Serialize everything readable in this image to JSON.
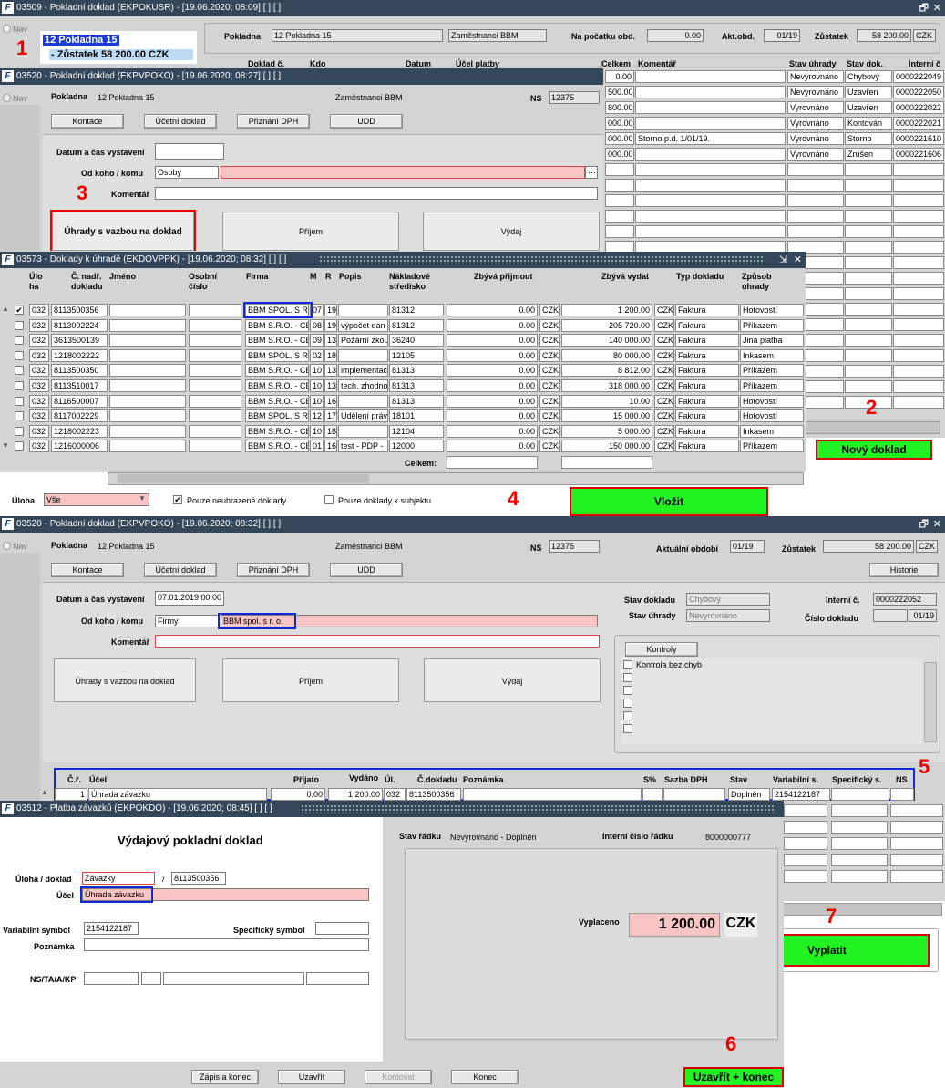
{
  "win1": {
    "title": "03509 - Pokladní doklad (EKPOKUSR) - [19.06.2020; 08:09]  [ ]  [ ]",
    "nav": "Nav",
    "tree_item1": "12 Pokladna 15",
    "tree_item2": "- Zůstatek 58 200.00 CZK",
    "lbl_pokladna": "Pokladna",
    "pokladna_value": "12 Pokladna 15",
    "zam_value": "Zaměstnanci BBM",
    "lbl_pocatek": "Na počátku obd.",
    "pocatek_value": "0.00",
    "lbl_akt": "Akt.obd.",
    "akt_value": "01/19",
    "lbl_zust": "Zůstatek",
    "zust_value": "58 200.00",
    "zust_cur": "CZK",
    "headers": {
      "doklad": "Doklad č.",
      "kdo": "Kdo",
      "datum": "Datum",
      "ucel": "Účel platby",
      "celkem": "Celkem",
      "koment": "Komentář",
      "stav_uhr": "Stav úhrady",
      "stav_dok": "Stav dok.",
      "interni": "Interní č"
    },
    "rows": [
      {
        "celkem": "0.00",
        "koment": "",
        "stav_uhr": "Nevyrovnáno",
        "stav_dok": "Chybový",
        "interni": "0000222049"
      },
      {
        "celkem": "500.00",
        "koment": "",
        "stav_uhr": "Nevyrovnáno",
        "stav_dok": "Uzavřen",
        "interni": "0000222050"
      },
      {
        "celkem": "800.00",
        "koment": "",
        "stav_uhr": "Vyrovnáno",
        "stav_dok": "Uzavřen",
        "interni": "0000222022"
      },
      {
        "celkem": "000.00",
        "koment": "",
        "stav_uhr": "Vyrovnáno",
        "stav_dok": "Kontován",
        "interni": "0000222021"
      },
      {
        "celkem": "000.00",
        "koment": "Storno p.d. 1/01/19.",
        "stav_uhr": "Vyrovnáno",
        "stav_dok": "Storno",
        "interni": "0000221610"
      },
      {
        "celkem": "000.00",
        "koment": "",
        "stav_uhr": "Vyrovnáno",
        "stav_dok": "Zrušen",
        "interni": "0000221606"
      }
    ],
    "btn_novy": "Nový doklad"
  },
  "win2": {
    "title": "03520 - Pokladní doklad (EKPVPOKO) - [19.06.2020; 08:27]  [ ]  [ ]",
    "nav": "Nav",
    "lbl_pokladna": "Pokladna",
    "pokladna_value": "12 Pokladna 15",
    "zam_value": "Zaměstnanci BBM",
    "lbl_ns": "NS",
    "ns_value": "12375",
    "btn_kontace": "Kontace",
    "btn_ucetni": "Účetní doklad",
    "btn_dph": "Přiznání DPH",
    "btn_udd": "UDD",
    "lbl_datum": "Datum a čas vystavení",
    "lbl_odkoho": "Od koho / komu",
    "odkoho_value": "Osoby",
    "lbl_koment": "Komentář",
    "btn_uhrady": "Úhrady s vazbou na doklad",
    "btn_prijem": "Příjem",
    "btn_vydej": "Výdaj"
  },
  "win3": {
    "title": "03573 - Doklady k úhradě (EKDOVPPK) - [19.06.2020; 08:32]  [ ]  [ ]",
    "headers": {
      "uloha": "Úlo ha",
      "nadr": "Č. nadř. dokladu",
      "jmeno": "Jméno",
      "osobni": "Osobní číslo",
      "firma": "Firma",
      "m": "M",
      "r": "R",
      "popis": "Popis",
      "nakl": "Nákladové středisko",
      "prijmout": "Zbývá přijmout",
      "vydat": "Zbývá vydat",
      "typ": "Typ dokladu",
      "zpusob": "Způsob úhrady"
    },
    "rows": [
      {
        "chk": "✔",
        "uloha": "032",
        "nadr": "8113500356",
        "firma": "BBM SPOL. S R",
        "m": "07",
        "r": "19",
        "popis": "",
        "nakl": "81312",
        "prijmout": "0.00",
        "cur1": "CZK",
        "vydat": "1 200.00",
        "cur2": "CZK",
        "typ": "Faktura",
        "zpusob": "Hotovostí"
      },
      {
        "chk": "",
        "uloha": "032",
        "nadr": "8113002224",
        "firma": "BBM S.R.O. - CE",
        "m": "08",
        "r": "19",
        "popis": "výpočet dan",
        "nakl": "81312",
        "prijmout": "0.00",
        "cur1": "CZK",
        "vydat": "205 720.00",
        "cur2": "CZK",
        "typ": "Faktura",
        "zpusob": "Příkazem"
      },
      {
        "chk": "",
        "uloha": "032",
        "nadr": "3613500139",
        "firma": "BBM S.R.O. - CE",
        "m": "09",
        "r": "13",
        "popis": "Požární zkou",
        "nakl": "36240",
        "prijmout": "0.00",
        "cur1": "CZK",
        "vydat": "140 000.00",
        "cur2": "CZK",
        "typ": "Faktura",
        "zpusob": "Jiná platba"
      },
      {
        "chk": "",
        "uloha": "032",
        "nadr": "1218002222",
        "firma": "BBM SPOL. S R",
        "m": "02",
        "r": "18",
        "popis": "",
        "nakl": "12105",
        "prijmout": "0.00",
        "cur1": "CZK",
        "vydat": "80 000.00",
        "cur2": "CZK",
        "typ": "Faktura",
        "zpusob": "Inkasem"
      },
      {
        "chk": "",
        "uloha": "032",
        "nadr": "8113500350",
        "firma": "BBM S.R.O. - CE",
        "m": "10",
        "r": "13",
        "popis": "implementac",
        "nakl": "81313",
        "prijmout": "0.00",
        "cur1": "CZK",
        "vydat": "8 812.00",
        "cur2": "CZK",
        "typ": "Faktura",
        "zpusob": "Příkazem"
      },
      {
        "chk": "",
        "uloha": "032",
        "nadr": "8113510017",
        "firma": "BBM S.R.O. - CE",
        "m": "10",
        "r": "13",
        "popis": "tech. zhodno",
        "nakl": "81313",
        "prijmout": "0.00",
        "cur1": "CZK",
        "vydat": "318 000.00",
        "cur2": "CZK",
        "typ": "Faktura",
        "zpusob": "Příkazem"
      },
      {
        "chk": "",
        "uloha": "032",
        "nadr": "8116500007",
        "firma": "BBM S.R.O. - CE",
        "m": "10",
        "r": "16",
        "popis": "",
        "nakl": "81313",
        "prijmout": "0.00",
        "cur1": "CZK",
        "vydat": "10.00",
        "cur2": "CZK",
        "typ": "Faktura",
        "zpusob": "Hotovostí"
      },
      {
        "chk": "",
        "uloha": "032",
        "nadr": "8117002229",
        "firma": "BBM SPOL. S R",
        "m": "12",
        "r": "17",
        "popis": "Udělení práv",
        "nakl": "18101",
        "prijmout": "0.00",
        "cur1": "CZK",
        "vydat": "15 000.00",
        "cur2": "CZK",
        "typ": "Faktura",
        "zpusob": "Hotovostí"
      },
      {
        "chk": "",
        "uloha": "032",
        "nadr": "1218002223",
        "firma": "BBM S.R.O. - CE",
        "m": "10",
        "r": "18",
        "popis": "",
        "nakl": "12104",
        "prijmout": "0.00",
        "cur1": "CZK",
        "vydat": "5 000.00",
        "cur2": "CZK",
        "typ": "Faktura",
        "zpusob": "Inkasem"
      },
      {
        "chk": "",
        "uloha": "032",
        "nadr": "1216000006",
        "firma": "BBM S.R.O. - CE",
        "m": "01",
        "r": "16",
        "popis": "test - PDP -",
        "nakl": "12000",
        "prijmout": "0.00",
        "cur1": "CZK",
        "vydat": "150 000.00",
        "cur2": "CZK",
        "typ": "Faktura",
        "zpusob": "Příkazem"
      }
    ],
    "celkem_label": "Celkem:",
    "lbl_uloha": "Úloha",
    "uloha_value": "Vše",
    "chk1": "Pouze neuhrazené doklady",
    "chk2": "Pouze doklady k subjektu",
    "btn_vlozit": "Vložit"
  },
  "win4": {
    "title": "03520 - Pokladní doklad (EKPVPOKO) - [19.06.2020; 08:32]  [ ]  [ ]",
    "nav": "Nav",
    "lbl_pokladna": "Pokladna",
    "pokladna_value": "12 Pokladna 15",
    "zam_value": "Zaměstnanci BBM",
    "lbl_ns": "NS",
    "ns_value": "12375",
    "lbl_akt": "Aktuální období",
    "akt_value": "01/19",
    "lbl_zust": "Zůstatek",
    "zust_value": "58 200.00",
    "zust_cur": "CZK",
    "btn_kontace": "Kontace",
    "btn_ucetni": "Účetní doklad",
    "btn_dph": "Přiznání DPH",
    "btn_udd": "UDD",
    "btn_historie": "Historie",
    "lbl_datum": "Datum a čas vystavení",
    "datum_value": "07.01.2019 00:00",
    "lbl_odkoho": "Od koho / komu",
    "odkoho_value": "Firmy",
    "firma_value": "BBM spol. s r. o.",
    "lbl_koment": "Komentář",
    "lbl_stavdok": "Stav dokladu",
    "stavdok_value": "Chybový",
    "lbl_stavuhr": "Stav úhrady",
    "stavuhr_value": "Nevyrovnáno",
    "lbl_interni": "Interní č.",
    "interni_value": "0000222052",
    "lbl_cislo": "Číslo dokladu",
    "cislo_value": "01/19",
    "btn_kontroly": "Kontroly",
    "kontrola1": "Kontrola bez chyb",
    "btn_uhrady": "Úhrady s vazbou na doklad",
    "btn_prijem": "Příjem",
    "btn_vydej": "Výdaj",
    "headers": {
      "cr": "Č.ř.",
      "ucel": "Účel",
      "prijato": "Přijato",
      "vydano": "Vydáno",
      "ul": "Úl.",
      "cdokladu": "Č.dokladu",
      "poznamka": "Poznámka",
      "s": "S%",
      "sazba": "Sazba DPH",
      "stav": "Stav",
      "var": "Variabilní s.",
      "spec": "Specifický s.",
      "ns": "NS"
    },
    "row": {
      "cr": "1",
      "ucel": "Úhrada závazku",
      "prijato": "0.00",
      "vydano": "1 200.00",
      "ul": "032",
      "cdokladu": "8113500356",
      "stav": "Doplněn",
      "var": "2154122187"
    },
    "btn_vyplatit": "Vyplatit"
  },
  "win5": {
    "title": "03512 - Platba závazků (EKPOKDO) - [19.06.2020; 08:45]  [ ]  [ ]",
    "heading": "Výdajový pokladní doklad",
    "lbl_stav": "Stav řádku",
    "stav_value": "Nevyrovnáno - Doplněn",
    "lbl_interni": "Interní číslo řádku",
    "interni_value": "8000000777",
    "lbl_uloha": "Úloha / doklad",
    "uloha_value": "Závazky",
    "slash": "/",
    "doklad_value": "8113500356",
    "lbl_ucel": "Účel",
    "ucel_value": "Úhrada závazku",
    "lbl_var": "Variabilní symbol",
    "var_value": "2154122187",
    "lbl_spec": "Specifický symbol",
    "lbl_pozn": "Poznámka",
    "lbl_ns": "NS/TA/A/KP",
    "lbl_vyplaceno": "Vyplaceno",
    "vyplaceno_value": "1 200.00",
    "vyplaceno_cur": "CZK",
    "btn_zapis": "Zápis a konec",
    "btn_uzavrit": "Uzavřít",
    "btn_kontovat": "Kontovat",
    "btn_konec": "Konec",
    "btn_uzavrit_konec": "Uzavřít + konec"
  },
  "annotations": {
    "n1": "1",
    "n2": "2",
    "n3": "3",
    "n4": "4",
    "n5": "5",
    "n6": "6",
    "n7": "7"
  },
  "colors": {
    "titlebar": "#33465a",
    "pink": "#f9c4c4",
    "green": "#22f222",
    "annotation_red": "#e00000",
    "annotation_blue": "#1428d8"
  }
}
